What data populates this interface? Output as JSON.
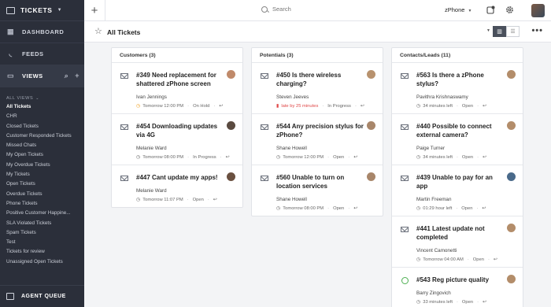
{
  "sidebar": {
    "module": "TICKETS",
    "items": [
      {
        "label": "DASHBOARD",
        "icon": "grid-icon"
      },
      {
        "label": "FEEDS",
        "icon": "rss-icon"
      },
      {
        "label": "VIEWS",
        "icon": "ticket-icon"
      }
    ],
    "all_views_label": "ALL VIEWS",
    "views": [
      "All Tickets",
      "CHR",
      "Closed Tickets",
      "Customer Responded Tickets",
      "Missed Chats",
      "My Open Tickets",
      "My Overdue Tickets",
      "My Tickets",
      "Open Tickets",
      "Overdue Tickets",
      "Phone Tickets",
      "Positive Customer Happine...",
      "SLA Violated Tickets",
      "Spam Tickets",
      "Test",
      "Tickets for review",
      "Unassigned Open Tickets"
    ],
    "bottom_label": "AGENT QUEUE"
  },
  "topbar": {
    "search_placeholder": "Search",
    "department": "zPhone"
  },
  "subheader": {
    "title": "All Tickets"
  },
  "columns": [
    {
      "title": "Customers (3)",
      "cards": [
        {
          "title": "#349 Need replacement for shattered zPhone screen",
          "contact": "Ivan Jennings",
          "due": "Tomorrow 12:00 PM",
          "status": "On Hold",
          "channel": "email",
          "due_color": "orange",
          "avatar_color": "#c08a6a"
        },
        {
          "title": "#454 Downloading updates via 4G",
          "contact": "Melanie Ward",
          "due": "Tomorrow 08:00 PM",
          "status": "In Progress",
          "channel": "email",
          "due_color": "normal",
          "avatar_color": "#5a4a40"
        },
        {
          "title": "#447 Cant update my apps!",
          "contact": "Melanie Ward",
          "due": "Tomorrow 11:07 PM",
          "status": "Open",
          "channel": "email",
          "due_color": "normal",
          "avatar_color": "#6a5040"
        }
      ]
    },
    {
      "title": "Potentials (3)",
      "cards": [
        {
          "title": "#450 Is there wireless charging?",
          "contact": "Steven Jeeves",
          "due": "late by 25 minutes",
          "status": "In Progress",
          "channel": "email",
          "due_color": "red",
          "avatar_color": "#b8926e"
        },
        {
          "title": "#544 Any precision stylus for zPhone?",
          "contact": "Shane Howell",
          "due": "Tomorrow 12:00 PM",
          "status": "Open",
          "channel": "email",
          "due_color": "normal",
          "avatar_color": "#a8866a"
        },
        {
          "title": "#560 Unable to turn on location services",
          "contact": "Shane Howell",
          "due": "Tomorrow 08:00 PM",
          "status": "Open",
          "channel": "email",
          "due_color": "normal",
          "avatar_color": "#a8866a"
        }
      ]
    },
    {
      "title": "Contacts/Leads (11)",
      "cards": [
        {
          "title": "#563 Is there a zPhone stylus?",
          "contact": "Pavithra Krishnaswamy",
          "due": "34 minutes left",
          "status": "Open",
          "channel": "email",
          "due_color": "normal",
          "avatar_color": "#b38d6a"
        },
        {
          "title": "#440 Possible to connect external camera?",
          "contact": "Paige Turner",
          "due": "34 minutes left",
          "status": "Open",
          "channel": "email",
          "due_color": "normal",
          "avatar_color": "#b38d6a"
        },
        {
          "title": "#439 Unable to pay for an app",
          "contact": "Martin Freeman",
          "due": "01:29 hour left",
          "status": "Open",
          "channel": "email",
          "due_color": "normal",
          "avatar_color": "#4a6a8a"
        },
        {
          "title": "#441 Latest update not completed",
          "contact": "Vincent Camonetti",
          "due": "Tomorrow 04:00 AM",
          "status": "Open",
          "channel": "email",
          "due_color": "normal",
          "avatar_color": "#b38d6a"
        },
        {
          "title": "#543 Reg picture quality",
          "contact": "Barry Zingovich",
          "due": "33 minutes left",
          "status": "Open",
          "channel": "chat",
          "due_color": "normal",
          "avatar_color": "#b38d6a"
        }
      ]
    }
  ]
}
